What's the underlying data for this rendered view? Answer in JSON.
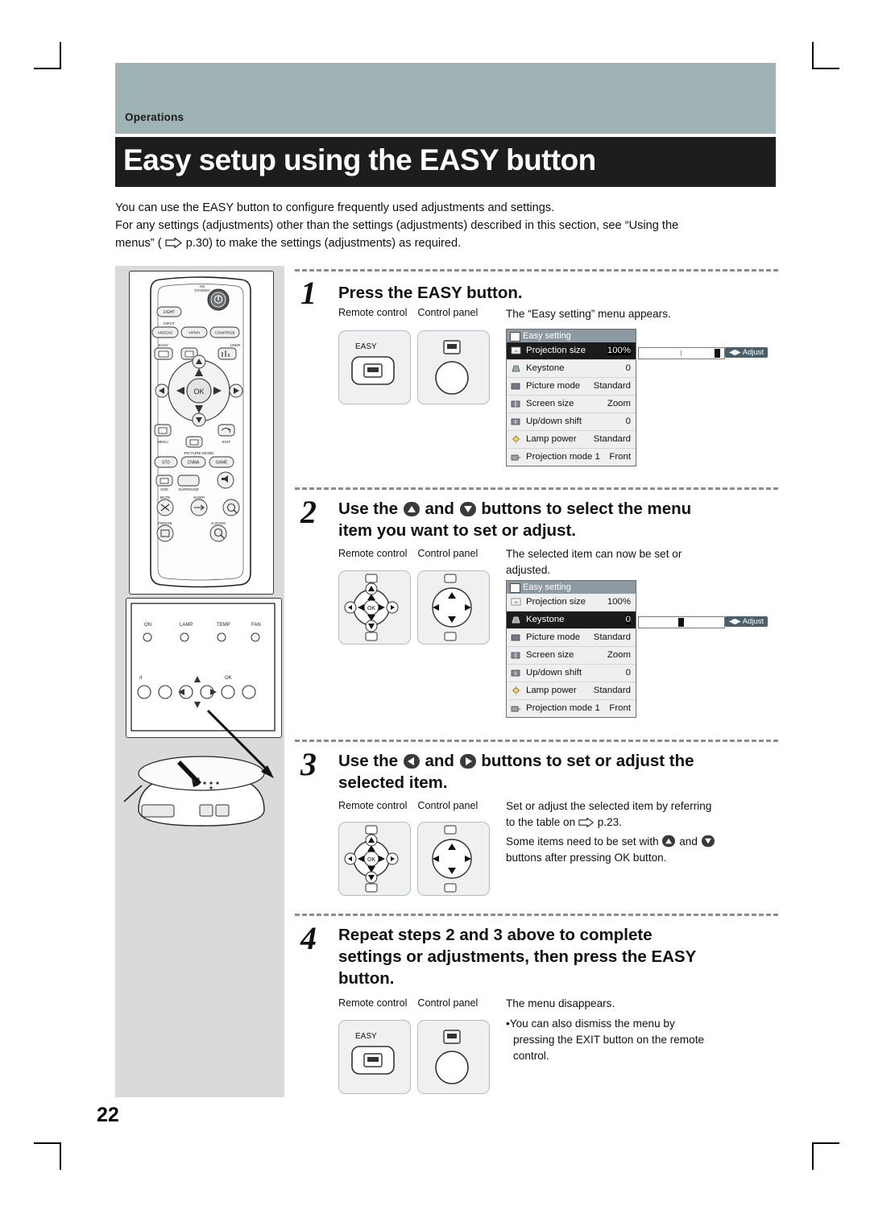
{
  "page": {
    "section_label": "Operations",
    "title": "Easy setup using the EASY button",
    "page_number": "22",
    "intro_line1": "You can use the EASY button to configure frequently used adjustments and settings.",
    "intro_line2": "For any settings (adjustments) other than the settings (adjustments) described in this section, see “Using the",
    "intro_line3_a": "menus” (",
    "intro_line3_b": "p.30) to make the settings (adjustments) as required."
  },
  "labels": {
    "remote_control": "Remote control",
    "control_panel": "Control panel",
    "easy_button": "EASY"
  },
  "steps": [
    {
      "num": "1",
      "heading": "Press the EASY button.",
      "body": "The “Easy setting” menu appears."
    },
    {
      "num": "2",
      "heading_line1": "Use the      and      buttons to select the menu",
      "heading_line2": "item you want to set or adjust.",
      "heading_pre": "Use the ",
      "heading_mid": " and ",
      "heading_post": " buttons to select the menu",
      "heading_second": "item you want to set or adjust.",
      "body_line1": "The selected item can now be set or",
      "body_line2": "adjusted."
    },
    {
      "num": "3",
      "heading_pre": "Use the ",
      "heading_mid": " and ",
      "heading_post": " buttons to set or adjust the",
      "heading_second": "selected item.",
      "body_line1": "Set or adjust the selected item by referring",
      "body_line2_a": "to the table on ",
      "body_line2_b": "p.23.",
      "body_line3_a": "Some items need to be set with ",
      "body_line3_b": " and ",
      "body_line4": "buttons after pressing OK button."
    },
    {
      "num": "4",
      "heading_line1": "Repeat steps 2 and 3 above to complete",
      "heading_line2": "settings or adjustments, then press the EASY",
      "heading_line3": "button.",
      "body_line1": "The menu disappears.",
      "body_line2": "•You can also dismiss the menu by",
      "body_line3": "pressing the EXIT button on the remote",
      "body_line4": "control."
    }
  ],
  "osd": {
    "title": "Easy setting",
    "adjust_label": "Adjust",
    "rows_step1": [
      {
        "name": "Projection size",
        "value": "100%",
        "selected": true
      },
      {
        "name": "Keystone",
        "value": "0",
        "selected": false
      },
      {
        "name": "Picture mode",
        "value": "Standard",
        "selected": false
      },
      {
        "name": "Screen size",
        "value": "Zoom",
        "selected": false
      },
      {
        "name": "Up/down shift",
        "value": "0",
        "selected": false
      },
      {
        "name": "Lamp power",
        "value": "Standard",
        "selected": false
      },
      {
        "name": "Projection mode 1",
        "value": "Front",
        "selected": false
      }
    ],
    "rows_step2": [
      {
        "name": "Projection size",
        "value": "100%",
        "selected": false
      },
      {
        "name": "Keystone",
        "value": "0",
        "selected": true
      },
      {
        "name": "Picture mode",
        "value": "Standard",
        "selected": false
      },
      {
        "name": "Screen size",
        "value": "Zoom",
        "selected": false
      },
      {
        "name": "Up/down shift",
        "value": "0",
        "selected": false
      },
      {
        "name": "Lamp power",
        "value": "Standard",
        "selected": false
      },
      {
        "name": "Projection mode 1",
        "value": "Front",
        "selected": false
      }
    ]
  },
  "remote": {
    "on_standby": "ON\nSTANDBY",
    "light": "LIGHT",
    "input": "INPUT",
    "video_s": "VIDEO/S",
    "ypbpr": "Y/PbPr",
    "comp_rgb": "COMP/RGB",
    "easy": "EASY",
    "user": "USER",
    "ok": "OK",
    "menu": "MENU",
    "exit": "EXIT",
    "picture_mode": "PICTURE MODE",
    "std": "STD",
    "cnma": "CNMA",
    "game": "GAME",
    "size": "SIZE",
    "surround": "SURROUND",
    "mute": "MUTE",
    "sleep": "SLEEP",
    "freeze": "FREEZE",
    "d_zoom": "D.ZOOM"
  },
  "control_panel": {
    "on": "ON",
    "lamp": "LAMP",
    "temp": "TEMP",
    "fan": "FAN",
    "ok": "OK"
  }
}
